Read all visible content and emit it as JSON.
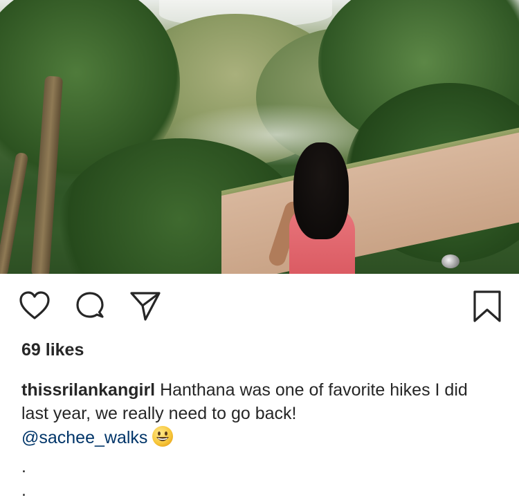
{
  "post": {
    "image_alt": "",
    "likes_text": "69 likes",
    "username": "thissrilankangirl",
    "caption_text": " Hanthana was one of favorite hikes I did last year, we really need to go back!",
    "mention": "@sachee_walks",
    "emoji_icon": "grinning-face-emoji",
    "dots": [
      ".",
      "."
    ]
  },
  "icons": {
    "like": "heart-outline-icon",
    "comment": "speech-bubble-icon",
    "share": "paper-plane-icon",
    "save": "bookmark-icon"
  }
}
